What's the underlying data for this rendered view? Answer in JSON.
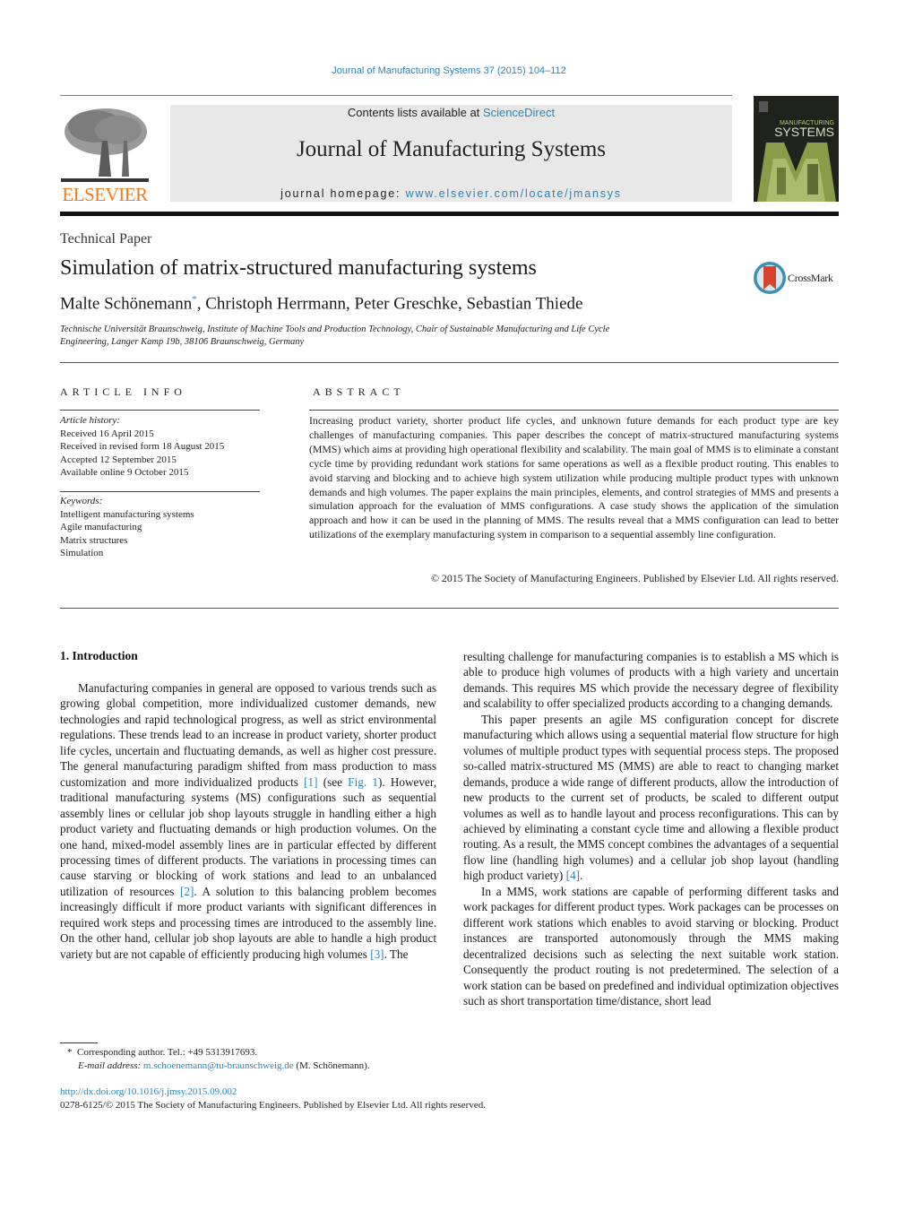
{
  "header": {
    "journal_reference": "Journal of Manufacturing Systems 37 (2015) 104–112",
    "contents_prefix": "Contents lists available at ",
    "contents_link": "ScienceDirect",
    "journal_title": "Journal of Manufacturing Systems",
    "homepage_prefix": "journal homepage: ",
    "homepage_link": "www.elsevier.com/locate/jmansys",
    "publisher_logo_text": "ELSEVIER",
    "cover_title": "SYSTEMS",
    "cover_subtitle": "MANUFACTURING"
  },
  "article": {
    "type": "Technical Paper",
    "title": "Simulation of matrix-structured manufacturing systems",
    "crossmark_label": "CrossMark",
    "authors": {
      "first": "Malte Schönemann",
      "first_marker": "*",
      "rest": ", Christoph Herrmann, Peter Greschke, Sebastian Thiede"
    },
    "affiliation_line1": "Technische Universität Braunschweig, Institute of Machine Tools and Production Technology, Chair of Sustainable Manufacturing and Life Cycle",
    "affiliation_line2": "Engineering, Langer Kamp 19b, 38106 Braunschweig, Germany"
  },
  "article_info": {
    "heading": "ARTICLE INFO",
    "history_label": "Article history:",
    "history": [
      "Received 16 April 2015",
      "Received in revised form 18 August 2015",
      "Accepted 12 September 2015",
      "Available online 9 October 2015"
    ],
    "keywords_label": "Keywords:",
    "keywords": [
      "Intelligent manufacturing systems",
      "Agile manufacturing",
      "Matrix structures",
      "Simulation"
    ]
  },
  "abstract": {
    "heading": "ABSTRACT",
    "text": "Increasing product variety, shorter product life cycles, and unknown future demands for each product type are key challenges of manufacturing companies. This paper describes the concept of matrix-structured manufacturing systems (MMS) which aims at providing high operational flexibility and scalability. The main goal of MMS is to eliminate a constant cycle time by providing redundant work stations for same operations as well as a flexible product routing. This enables to avoid starving and blocking and to achieve high system utilization while producing multiple product types with unknown demands and high volumes. The paper explains the main principles, elements, and control strategies of MMS and presents a simulation approach for the evaluation of MMS configurations. A case study shows the application of the simulation approach and how it can be used in the planning of MMS. The results reveal that a MMS configuration can lead to better utilizations of the exemplary manufacturing system in comparison to a sequential assembly line configuration.",
    "copyright": "© 2015 The Society of Manufacturing Engineers. Published by Elsevier Ltd. All rights reserved."
  },
  "body": {
    "section_heading": "1.  Introduction",
    "left_p1_a": "Manufacturing companies in general are opposed to various trends such as growing global competition, more individualized customer demands, new technologies and rapid technological progress, as well as strict environmental regulations. These trends lead to an increase in product variety, shorter product life cycles, uncertain and fluctuating demands, as well as higher cost pressure. The general manufacturing paradigm shifted from mass production to mass customization and more individualized products ",
    "ref1": "[1]",
    "left_p1_b": " (see ",
    "fig1": "Fig. 1",
    "left_p1_c": "). However, traditional manufacturing systems (MS) configurations such as sequential assembly lines or cellular job shop layouts struggle in handling either a high product variety and fluctuating demands or high production volumes. On the one hand, mixed-model assembly lines are in particular effected by different processing times of different products. The variations in processing times can cause starving or blocking of work stations and lead to an unbalanced utilization of resources ",
    "ref2": "[2]",
    "left_p1_d": ". A solution to this balancing problem becomes increasingly difficult if more product variants with significant differences in required work steps and processing times are introduced to the assembly line. On the other hand, cellular job shop layouts are able to handle a high product variety but are not capable of efficiently producing high volumes ",
    "ref3": "[3]",
    "left_p1_e": ". The",
    "right_p1": "resulting challenge for manufacturing companies is to establish a MS which is able to produce high volumes of products with a high variety and uncertain demands. This requires MS which provide the necessary degree of flexibility and scalability to offer specialized products according to a changing demands.",
    "right_p2_a": "This paper presents an agile MS configuration concept for discrete manufacturing which allows using a sequential material flow structure for high volumes of multiple product types with sequential process steps. The proposed so-called matrix-structured MS (MMS) are able to react to changing market demands, produce a wide range of different products, allow the introduction of new products to the current set of products, be scaled to different output volumes as well as to handle layout and process reconfigurations. This can by achieved by eliminating a constant cycle time and allowing a flexible product routing. As a result, the MMS concept combines the advantages of a sequential flow line (handling high volumes) and a cellular job shop layout (handling high product variety) ",
    "ref4": "[4]",
    "right_p2_b": ".",
    "right_p3": "In a MMS, work stations are capable of performing different tasks and work packages for different product types. Work packages can be processes on different work stations which enables to avoid starving or blocking. Product instances are transported autonomously through the MMS making decentralized decisions such as selecting the next suitable work station. Consequently the product routing is not predetermined. The selection of a work station can be based on predefined and individual optimization objectives such as short transportation time/distance, short lead"
  },
  "footnote": {
    "marker": "*",
    "corresponding": "Corresponding author. Tel.: +49 5313917693.",
    "email_label": "E-mail address:",
    "email": "m.schoenemann@tu-braunschweig.de",
    "email_suffix": " (M. Schönemann)."
  },
  "footer": {
    "doi": "http://dx.doi.org/10.1016/j.jmsy.2015.09.002",
    "issn_copyright": "0278-6125/© 2015 The Society of Manufacturing Engineers. Published by Elsevier Ltd. All rights reserved."
  }
}
